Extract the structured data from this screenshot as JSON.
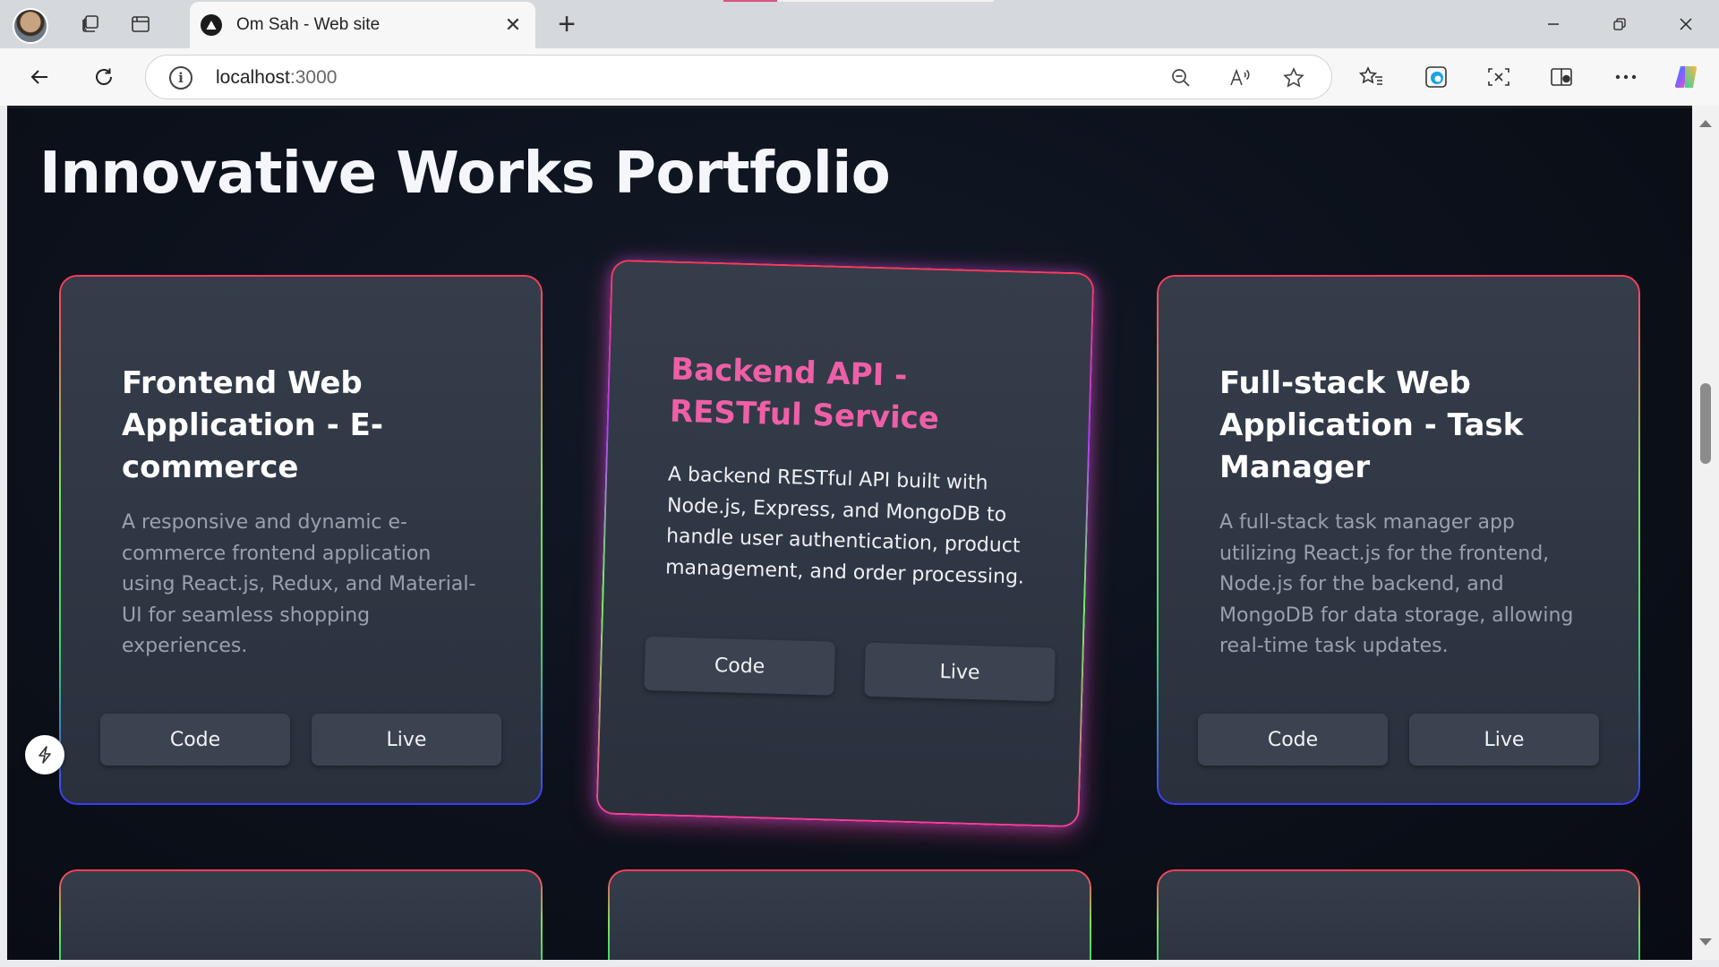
{
  "browser": {
    "tab_title": "Om Sah - Web site",
    "url_host": "localhost",
    "url_port": ":3000",
    "new_tab_symbol": "+",
    "close_symbol": "✕"
  },
  "page": {
    "title": "Innovative Works Portfolio"
  },
  "projects": [
    {
      "title": "Frontend Web Application - E-commerce",
      "description": "A responsive and dynamic e-commerce frontend application using React.js, Redux, and Material-UI for seamless shopping experiences.",
      "code_label": "Code",
      "live_label": "Live"
    },
    {
      "title": "Backend API - RESTful Service",
      "description": "A backend RESTful API built with Node.js, Express, and MongoDB to handle user authentication, product management, and order processing.",
      "code_label": "Code",
      "live_label": "Live"
    },
    {
      "title": "Full-stack Web Application - Task Manager",
      "description": "A full-stack task manager app utilizing React.js for the frontend, Node.js for the backend, and MongoDB for data storage, allowing real-time task updates.",
      "code_label": "Code",
      "live_label": "Live"
    }
  ],
  "colors": {
    "page_bg": "#0c111b",
    "card_bg": "#2f3644",
    "featured_title": "#ee5fa7",
    "button_bg": "#3b4350"
  },
  "icons": [
    "profile-avatar",
    "workspaces-icon",
    "tab-actions-icon",
    "site-favicon",
    "close-icon",
    "new-tab-icon",
    "minimize-icon",
    "restore-icon",
    "window-close-icon",
    "back-icon",
    "refresh-icon",
    "info-icon",
    "zoom-out-icon",
    "read-aloud-icon",
    "favorite-star-icon",
    "favorites-icon",
    "edge-icon",
    "screenshot-icon",
    "collections-icon",
    "more-icon",
    "copilot-icon",
    "bolt-icon"
  ]
}
